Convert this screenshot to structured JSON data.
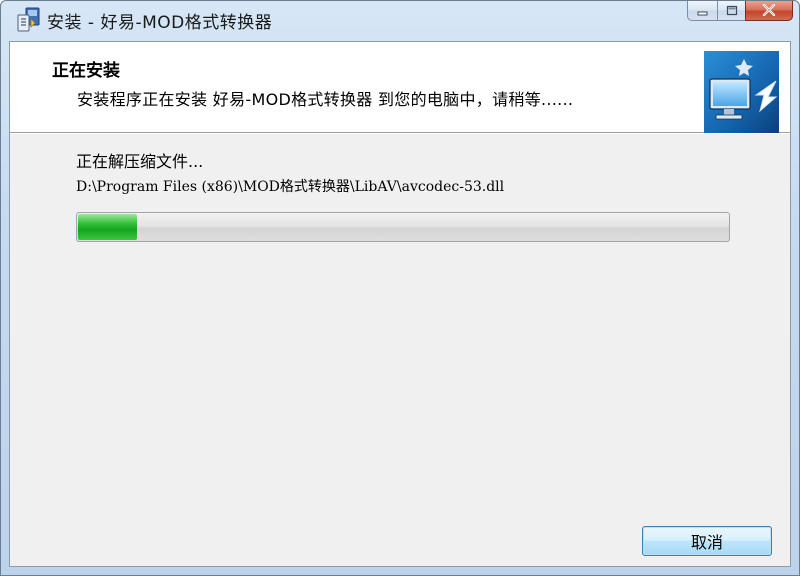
{
  "window": {
    "title": "安装 - 好易-MOD格式转换器"
  },
  "header": {
    "title": "正在安装",
    "subtitle": "安装程序正在安装 好易-MOD格式转换器 到您的电脑中，请稍等......"
  },
  "status": {
    "action": "正在解压缩文件...",
    "file_path": "D:\\Program Files (x86)\\MOD格式转换器\\LibAV\\avcodec-53.dll"
  },
  "progress": {
    "fraction": 0.09
  },
  "buttons": {
    "cancel_label": "取消"
  },
  "icons": {
    "app": "installer-app-icon",
    "header": "computer-install-arrow-icon",
    "minimize": "minimize-icon",
    "maximize": "maximize-icon",
    "close": "close-icon"
  },
  "colors": {
    "progress_fill": "#16a51f",
    "close_button": "#c4442c"
  }
}
